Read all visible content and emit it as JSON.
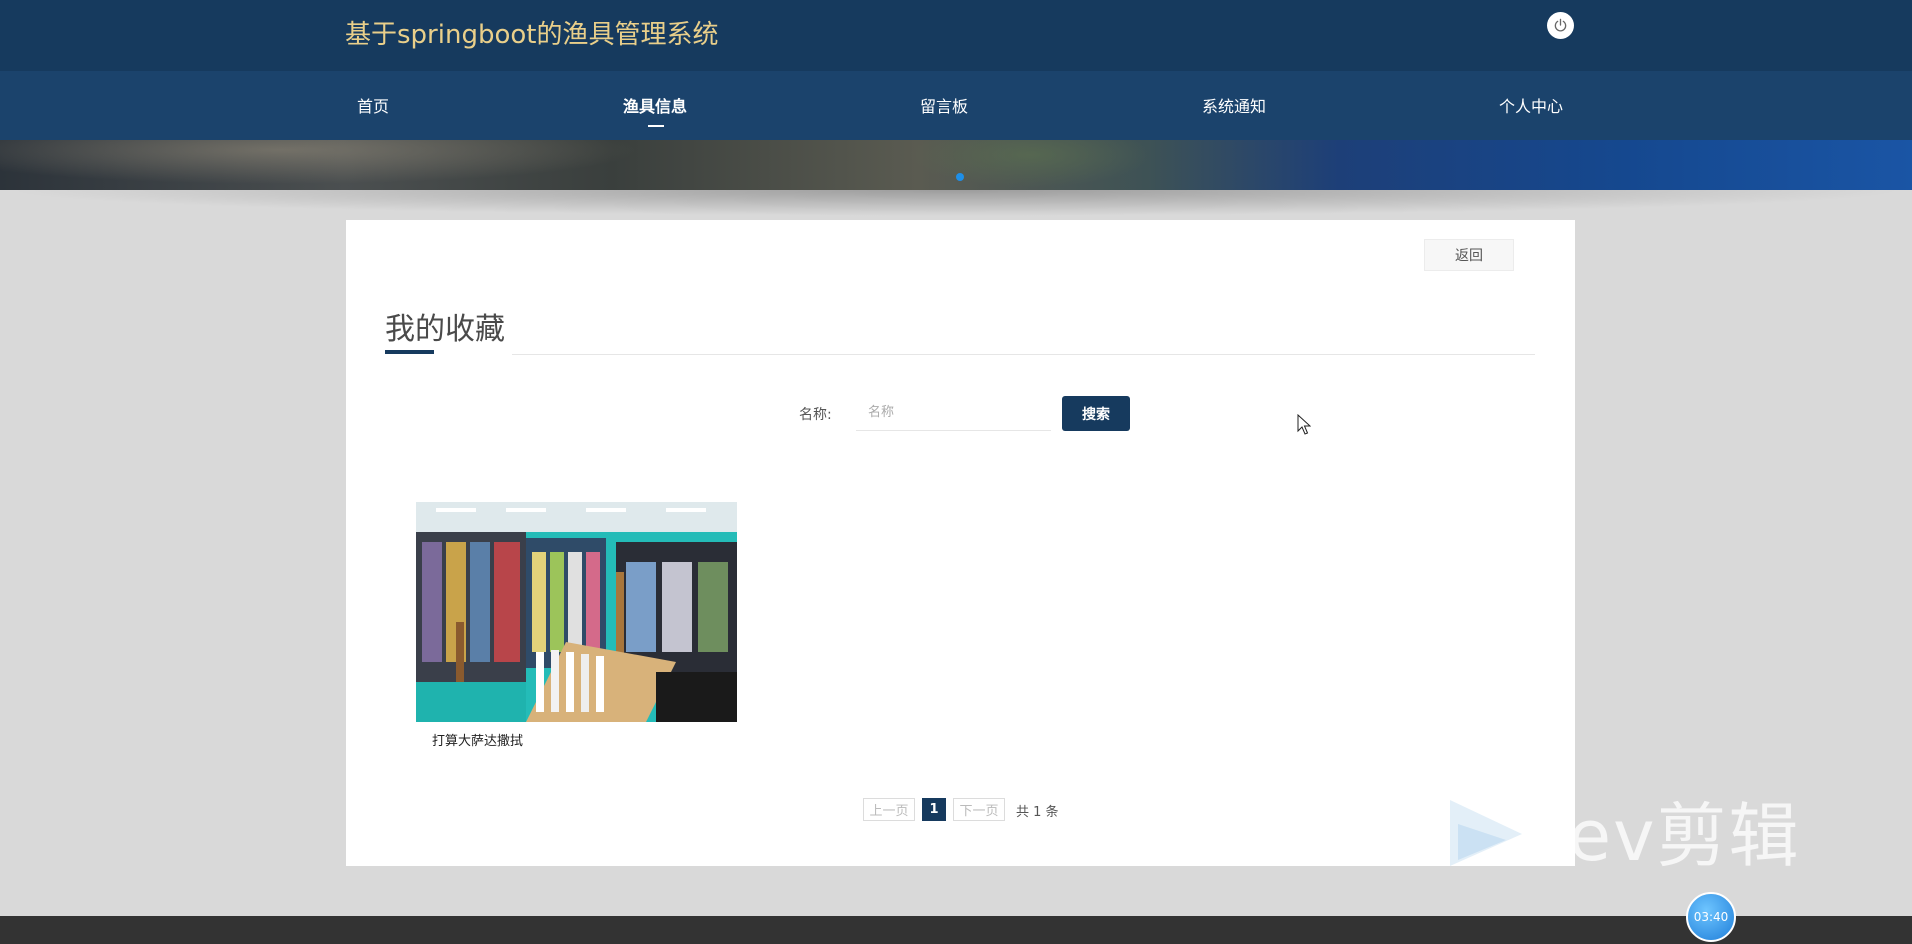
{
  "header": {
    "site_title": "基于springboot的渔具管理系统",
    "power_icon": "power-icon"
  },
  "nav": {
    "items": [
      {
        "label": "首页",
        "active": false
      },
      {
        "label": "渔具信息",
        "active": true
      },
      {
        "label": "留言板",
        "active": false
      },
      {
        "label": "系统通知",
        "active": false
      },
      {
        "label": "个人中心",
        "active": false
      }
    ]
  },
  "banner": {
    "slides": 1,
    "active_slide": 1
  },
  "page": {
    "back_label": "返回",
    "section_title": "我的收藏"
  },
  "search": {
    "label": "名称:",
    "placeholder": "名称",
    "value": "",
    "button_label": "搜索"
  },
  "favorites": [
    {
      "name": "打算大萨达撒拭"
    }
  ],
  "pagination": {
    "prev_label": "上一页",
    "current_page": "1",
    "next_label": "下一页",
    "total_text": "共 1 条"
  },
  "overlay": {
    "watermark_text": "ev剪辑",
    "timer": "03:40"
  },
  "colors": {
    "header_bg": "#163a5e",
    "nav_bg": "#1b436c",
    "title_gold": "#e9cf8a",
    "accent": "#163a5e"
  }
}
